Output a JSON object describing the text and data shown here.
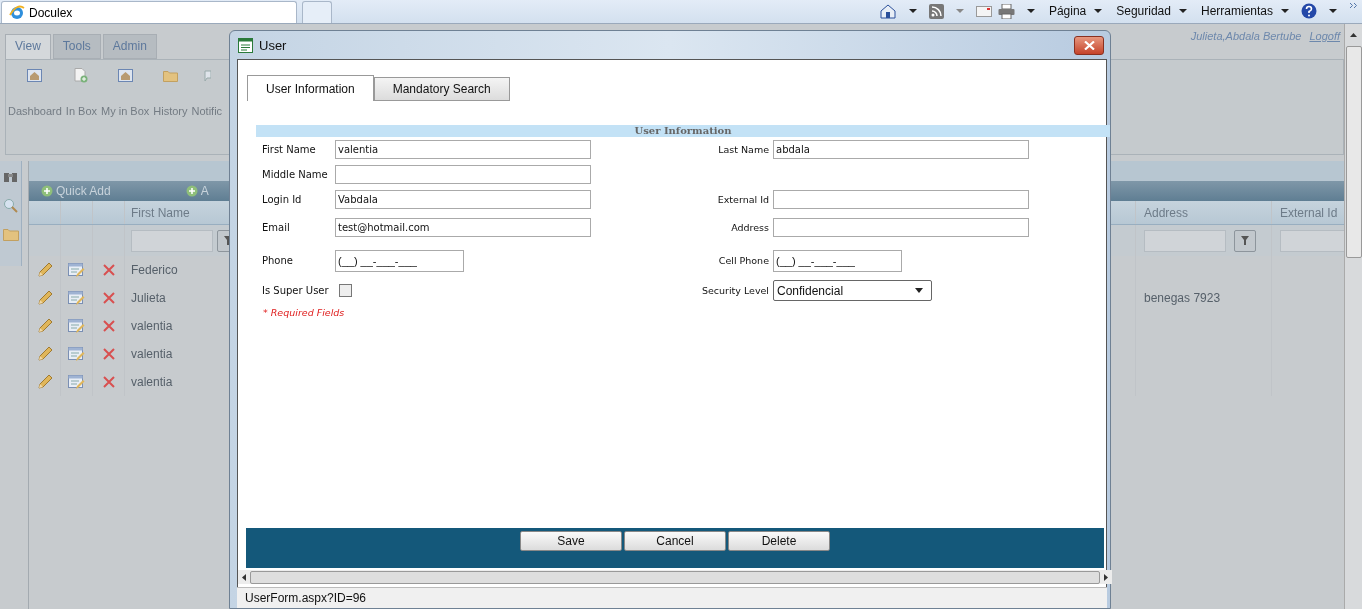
{
  "browser": {
    "tab_title": "Doculex",
    "menus": [
      "Página",
      "Seguridad",
      "Herramientas"
    ]
  },
  "app": {
    "tabs": [
      {
        "label": "View",
        "selected": true
      },
      {
        "label": "Tools",
        "selected": false
      },
      {
        "label": "Admin",
        "selected": false
      }
    ],
    "ribbon": [
      {
        "label": "Dashboard",
        "kind": "house"
      },
      {
        "label": "In Box",
        "kind": "new-doc"
      },
      {
        "label": "My in Box",
        "kind": "house"
      },
      {
        "label": "History",
        "kind": "folder"
      },
      {
        "label": "Notific",
        "kind": "bubble"
      }
    ],
    "user": "Julieta,Abdala Bertube",
    "logoff": "Logoff"
  },
  "grid": {
    "actions": [
      "Quick Add",
      "A"
    ],
    "columns": [
      "First Name",
      "Address",
      "External Id"
    ],
    "rows": [
      {
        "first_name": "Federico"
      },
      {
        "first_name": "Julieta",
        "address": "benegas 7923"
      },
      {
        "first_name": "valentia"
      },
      {
        "first_name": "valentia"
      },
      {
        "first_name": "valentia"
      }
    ]
  },
  "dialog": {
    "title": "User",
    "tabs": [
      {
        "label": "User Information",
        "selected": true
      },
      {
        "label": "Mandatory Search",
        "selected": false
      }
    ],
    "section": "User Information",
    "rows": [
      {
        "left": {
          "label": "First Name",
          "kind": "text",
          "value": "valentia"
        },
        "right": {
          "label": "Last Name",
          "kind": "text",
          "value": "abdala"
        }
      },
      {
        "left": {
          "label": "Middle Name",
          "kind": "text"
        }
      },
      {
        "left": {
          "label": "Login Id",
          "kind": "text",
          "value": "Vabdala"
        },
        "right": {
          "label": "External Id",
          "kind": "text"
        }
      },
      {
        "left": {
          "label": "Email",
          "kind": "text",
          "value": "test@hotmail.com"
        },
        "right": {
          "label": "Address",
          "kind": "text"
        }
      },
      {
        "left": {
          "label": "Phone",
          "kind": "mask",
          "value": "(__) __-___-___"
        },
        "right": {
          "label": "Cell Phone",
          "kind": "mask",
          "value": "(__) __-___-___"
        }
      },
      {
        "left": {
          "label": "Is Super User",
          "kind": "checkbox",
          "checked": false
        },
        "right": {
          "label": "Security Level",
          "kind": "select",
          "value": "Confidencial"
        }
      }
    ],
    "required_note": "* Required Fields",
    "buttons": [
      "Save",
      "Cancel",
      "Delete"
    ],
    "status": "UserForm.aspx?ID=96"
  }
}
